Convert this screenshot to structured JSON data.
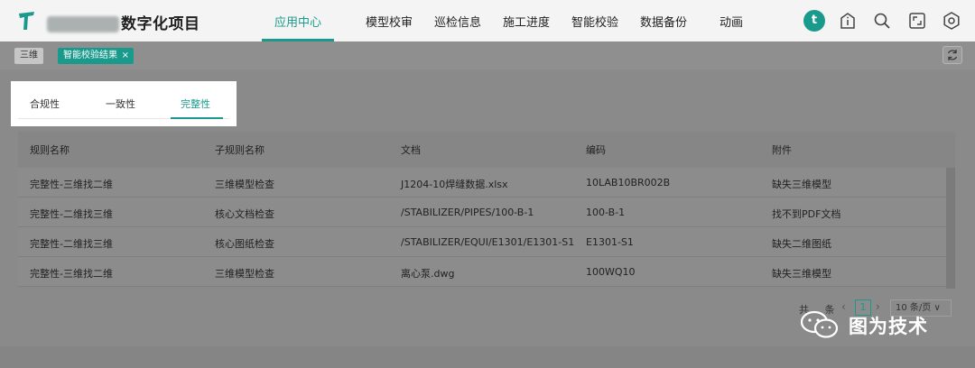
{
  "header": {
    "project_title": "数字化项目",
    "nav": [
      {
        "label": "应用中心",
        "active": true
      },
      {
        "label": "模型校审"
      },
      {
        "label": "巡检信息"
      },
      {
        "label": "施工进度"
      },
      {
        "label": "智能校验"
      },
      {
        "label": "数据备份"
      },
      {
        "label": "动画"
      }
    ],
    "avatar_letter": "t",
    "icons": [
      "info-icon",
      "search-icon",
      "fullscreen-icon",
      "settings-icon"
    ]
  },
  "tabs": {
    "items": [
      {
        "label": "三维"
      },
      {
        "label": "智能校验结果",
        "active": true,
        "closable": "×"
      }
    ]
  },
  "subtabs": [
    {
      "label": "合规性"
    },
    {
      "label": "一致性"
    },
    {
      "label": "完整性",
      "active": true
    }
  ],
  "table": {
    "columns": [
      "规则名称",
      "子规则名称",
      "文档",
      "编码",
      "附件"
    ],
    "rows": [
      [
        "完整性-三维找二维",
        "三维模型检查",
        "J1204-10焊缝数据.xlsx",
        "10LAB10BR002B",
        "缺失三维模型"
      ],
      [
        "完整性-二维找三维",
        "核心文档检查",
        "/STABILIZER/PIPES/100-B-1",
        "100-B-1",
        "找不到PDF文档"
      ],
      [
        "完整性-二维找三维",
        "核心图纸检查",
        "/STABILIZER/EQUI/E1301/E1301-S1",
        "E1301-S1",
        "缺失二维图纸"
      ],
      [
        "完整性-三维找二维",
        "三维模型检查",
        "离心泵.dwg",
        "100WQ10",
        "缺失三维模型"
      ]
    ]
  },
  "pagination": {
    "total_label": "共",
    "total_suffix": "条",
    "prev": "‹",
    "current_page": "1",
    "next": "›",
    "page_size": "10 条/页 ∨"
  },
  "watermark": {
    "text": "图为技术"
  },
  "colors": {
    "accent": "#1a9a8c",
    "overlay": "#8a8a8a"
  }
}
